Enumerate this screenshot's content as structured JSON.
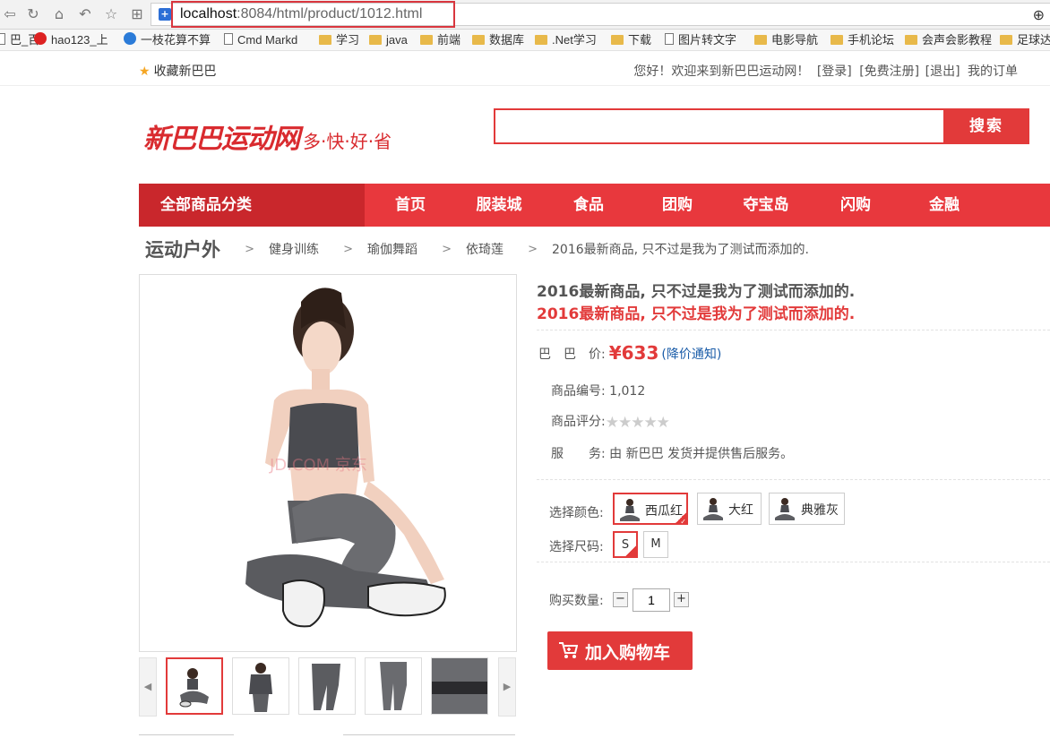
{
  "browser": {
    "url_host": "localhost",
    "url_rest": ":8084/html/product/1012.html",
    "bookmarks": [
      {
        "label": "巴_百",
        "icon": "page"
      },
      {
        "label": "hao123_上",
        "icon": "hao"
      },
      {
        "label": "一枝花算不算",
        "icon": "ie"
      },
      {
        "label": "Cmd Markd",
        "icon": "page"
      },
      {
        "label": "学习",
        "icon": "folder"
      },
      {
        "label": "java",
        "icon": "folder"
      },
      {
        "label": "前端",
        "icon": "folder"
      },
      {
        "label": "数据库",
        "icon": "folder"
      },
      {
        "label": ".Net学习",
        "icon": "folder"
      },
      {
        "label": "下载",
        "icon": "folder"
      },
      {
        "label": "图片转文字",
        "icon": "page"
      },
      {
        "label": "电影导航",
        "icon": "folder"
      },
      {
        "label": "手机论坛",
        "icon": "folder"
      },
      {
        "label": "会声会影教程",
        "icon": "folder"
      },
      {
        "label": "足球达",
        "icon": "folder"
      }
    ]
  },
  "topbar": {
    "favorite": "收藏新巴巴",
    "welcome": "您好！欢迎来到新巴巴运动网！",
    "login": "[登录]",
    "register": "[免费注册]",
    "logout": "[退出]",
    "orders": "我的订单"
  },
  "header": {
    "logo_main": "新巴巴运动网",
    "logo_slogan": "多·快·好·省",
    "search_button": "搜索",
    "search_placeholder": ""
  },
  "nav": {
    "category": "全部商品分类",
    "items": [
      "首页",
      "服装城",
      "食品",
      "团购",
      "夺宝岛",
      "闪购",
      "金融"
    ]
  },
  "breadcrumb": {
    "root": "运动户外",
    "items": [
      "健身训练",
      "瑜伽舞蹈",
      "依琦莲",
      "2016最新商品, 只不过是我为了测试而添加的."
    ]
  },
  "gallery": {
    "watermark": "JD.COM 京东"
  },
  "product": {
    "name": "2016最新商品, 只不过是我为了测试而添加的.",
    "subtitle": "2016最新商品, 只不过是我为了测试而添加的.",
    "price_label": "巴　巴　价:",
    "price": "¥633",
    "price_notify": "(降价通知)",
    "sku_label": "商品编号:",
    "sku": "1,012",
    "rating_label": "商品评分:",
    "rating": 0,
    "rating_max": 5,
    "service_label": "服　　务:",
    "service": "由 新巴巴 发货并提供售后服务。",
    "color_label": "选择颜色:",
    "colors": [
      "西瓜红",
      "大红",
      "典雅灰"
    ],
    "size_label": "选择尺码:",
    "sizes": [
      "S",
      "M"
    ],
    "qty_label": "购买数量:",
    "qty": "1",
    "cart_button": "加入购物车"
  },
  "colors": {
    "accent": "#e23a3a",
    "nav_dark": "#c9272c",
    "link": "#1a5ca8"
  }
}
